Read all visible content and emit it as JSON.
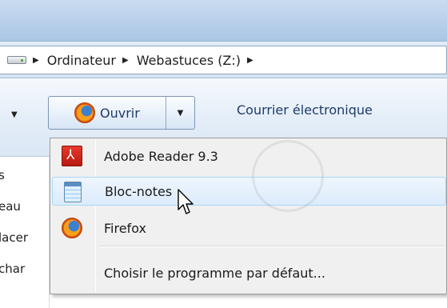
{
  "address": {
    "crumbs": [
      "Ordinateur",
      "Webastuces (Z:)"
    ]
  },
  "toolbar": {
    "open_label": "Ouvrir",
    "mail_label": "Courrier électronique"
  },
  "left_pane": {
    "items": [
      "s",
      "eau",
      "lacer",
      "char"
    ]
  },
  "open_with_menu": {
    "items": [
      {
        "label": "Adobe Reader 9.3",
        "icon": "adobe-reader-icon"
      },
      {
        "label": "Bloc-notes",
        "icon": "notepad-icon",
        "state": "hover"
      },
      {
        "label": "Firefox",
        "icon": "firefox-icon"
      }
    ],
    "choose_default_label": "Choisir le programme par défaut..."
  },
  "colors": {
    "titlebar": "#b9d0ea",
    "toolbar": "#e5eef8",
    "menu_bg": "#f0f0f0",
    "hover_border": "#a8d8f6",
    "button_text": "#1f3a6a"
  }
}
